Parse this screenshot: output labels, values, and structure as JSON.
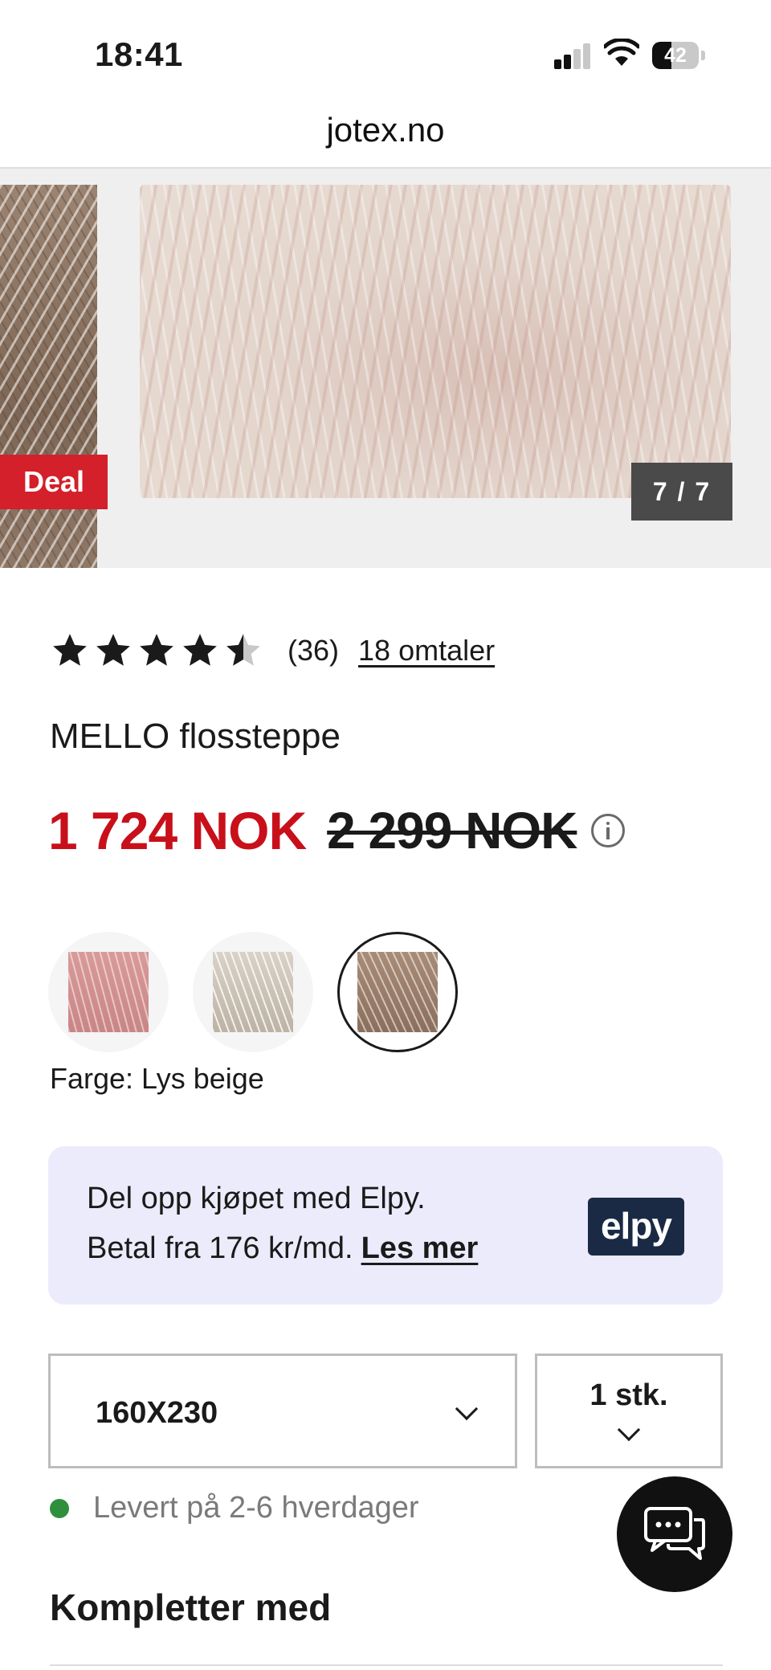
{
  "status_bar": {
    "time": "18:41",
    "battery_level": "42",
    "icons": [
      "cellular-signal-icon",
      "wifi-icon",
      "battery-icon"
    ]
  },
  "browser": {
    "url": "jotex.no"
  },
  "gallery": {
    "badge": "Deal",
    "counter": "7 / 7",
    "badge_color": "#d3202a"
  },
  "product": {
    "rating_value": 4.5,
    "rating_max": 5,
    "rating_count": "(36)",
    "reviews_link": "18 omtaler",
    "title": "MELLO flossteppe",
    "price_now": "1 724 NOK",
    "price_old": "2 299 NOK",
    "price_color": "#c8101a",
    "color_label": "Farge: Lys beige",
    "swatches": [
      "pink-swatch",
      "white-swatch",
      "beige-swatch"
    ],
    "selected_swatch_index": 2
  },
  "elpy": {
    "line1": "Del opp kjøpet med Elpy.",
    "line2": "Betal fra 176 kr/md.",
    "link": "Les mer",
    "logo": "elpy",
    "background": "#ebebfb"
  },
  "options": {
    "size": "160X230",
    "quantity": "1 stk."
  },
  "delivery": {
    "text": "Levert på 2-6 hverdager",
    "status_color": "#2f8f3d"
  },
  "section": {
    "heading": "Kompletter med"
  }
}
